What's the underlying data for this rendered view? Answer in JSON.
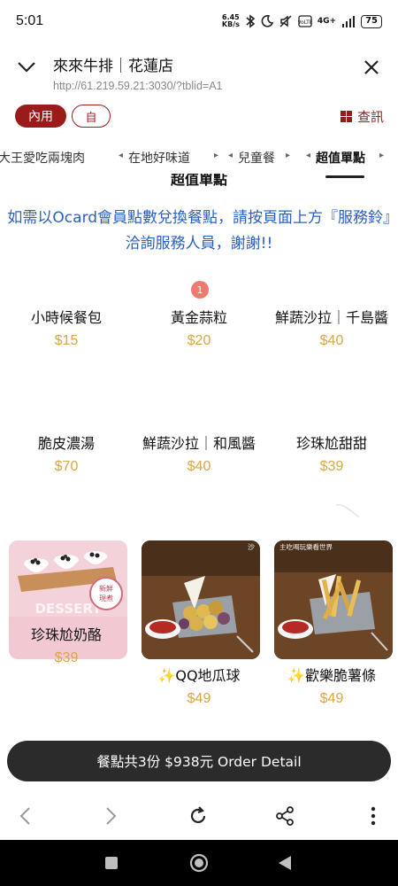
{
  "status": {
    "time": "5:01",
    "speed_top": "6.45",
    "speed_bottom": "KB/s",
    "net": "4G+",
    "battery": "75"
  },
  "browser": {
    "title": "來來牛排｜花蓮店",
    "url": "http://61.219.59.21:3030/?tblid=A1"
  },
  "mode": {
    "dine_in": "內用",
    "self": "自",
    "query": "查訊"
  },
  "tabs": [
    {
      "label": "大王愛吃兩塊肉"
    },
    {
      "label": "在地好味道"
    },
    {
      "label": "兒童餐"
    },
    {
      "label": "超值單點"
    }
  ],
  "section_title": "超值單點",
  "notice": "如需以Ocard會員點數兌換餐點，請按頁面上方『服務鈴』洽詢服務人員，謝謝!!",
  "badge": "1",
  "items": [
    {
      "name": "小時候餐包",
      "price": "$15"
    },
    {
      "name": "黃金蒜粒",
      "price": "$20"
    },
    {
      "name": "鮮蔬沙拉｜千島醬",
      "price": "$40"
    },
    {
      "name": "脆皮濃湯",
      "price": "$70"
    },
    {
      "name": "鮮蔬沙拉｜和風醬",
      "price": "$40"
    },
    {
      "name": "珍珠尬甜甜",
      "price": "$39"
    },
    {
      "name": "珍珠尬奶酪",
      "price": "$39"
    },
    {
      "name": "✨QQ地瓜球",
      "price": "$49"
    },
    {
      "name": "✨歡樂脆薯條",
      "price": "$49"
    }
  ],
  "thumb_texts": {
    "pudding_stamp_top": "新鮮",
    "pudding_stamp_bottom": "現煮",
    "pudding_watermark": "DESSERT",
    "fries_caption": "主吃喝玩樂看世界",
    "ball_caption": "沙"
  },
  "order_bar": "餐點共3份 $938元 Order Detail",
  "colors": {
    "accent": "#9b1b1b",
    "price": "#d9a646",
    "notice": "#2a5fc4",
    "order_bar": "#2b2b2b"
  }
}
